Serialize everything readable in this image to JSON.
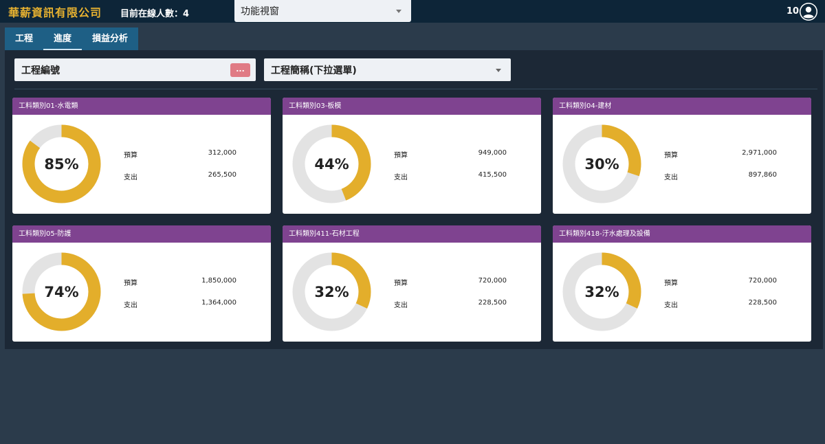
{
  "app": {
    "title": "華薪資訊有限公司",
    "online_text": "目前在線人數：4",
    "function_window": "功能視窗",
    "user_number": "10"
  },
  "tabs": [
    {
      "label": "工程",
      "active": false
    },
    {
      "label": "進度",
      "active": true
    },
    {
      "label": "損益分析",
      "active": false
    }
  ],
  "filters": {
    "project_code_label": "工程編號",
    "project_code_button": "...",
    "project_name_label": "工程簡稱(下拉選單)"
  },
  "labels": {
    "budget": "預算",
    "spend": "支出"
  },
  "colors": {
    "accent": "#e3ae2b",
    "track": "#e3e3e3",
    "card_header": "#7f4390",
    "brand": "#e8b230"
  },
  "cards": [
    {
      "title": "工料類別01-水電類",
      "percent": 85,
      "percent_text": "85%",
      "budget": "312,000",
      "spend": "265,500"
    },
    {
      "title": "工料類別03-板模",
      "percent": 44,
      "percent_text": "44%",
      "budget": "949,000",
      "spend": "415,500"
    },
    {
      "title": "工料類別04-建材",
      "percent": 30,
      "percent_text": "30%",
      "budget": "2,971,000",
      "spend": "897,860"
    },
    {
      "title": "工料類別05-防護",
      "percent": 74,
      "percent_text": "74%",
      "budget": "1,850,000",
      "spend": "1,364,000"
    },
    {
      "title": "工料類別411-石材工程",
      "percent": 32,
      "percent_text": "32%",
      "budget": "720,000",
      "spend": "228,500"
    },
    {
      "title": "工料類別418-汙水處理及設備",
      "percent": 32,
      "percent_text": "32%",
      "budget": "720,000",
      "spend": "228,500"
    }
  ]
}
